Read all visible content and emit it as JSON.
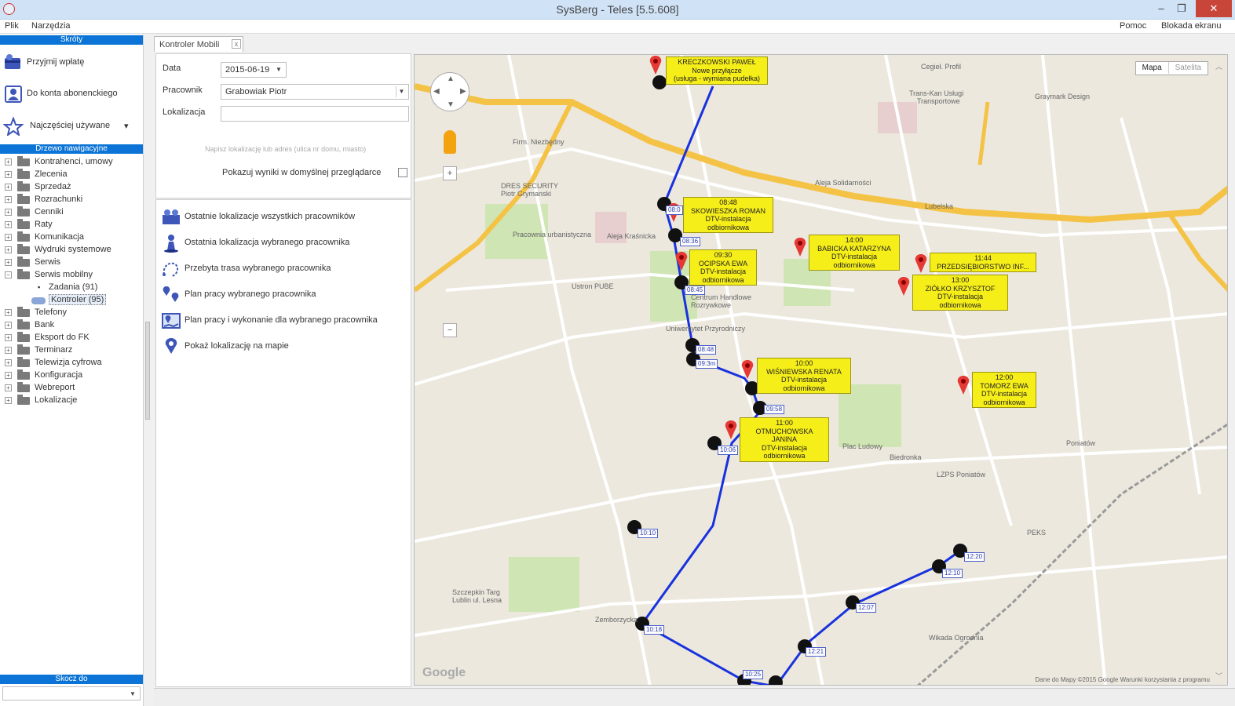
{
  "window": {
    "title": "SysBerg - Teles [5.5.608]",
    "controls": [
      "–",
      "❐",
      "✕"
    ]
  },
  "menu": {
    "left": [
      "Plik",
      "Narzędzia"
    ],
    "right": [
      "Pomoc",
      "Blokada ekranu"
    ]
  },
  "sidebar": {
    "skroty_header": "Skróty",
    "quick_actions": [
      {
        "label": "Przyjmij wpłatę",
        "icon": "payment-icon"
      },
      {
        "label": "Do konta abonenckiego",
        "icon": "subscriber-account-icon"
      },
      {
        "label": "Najczęściej używane",
        "icon": "star-icon",
        "arrow": "▾"
      }
    ],
    "nav_header": "Drzewo nawigacyjne",
    "tree": [
      {
        "label": "Kontrahenci, umowy"
      },
      {
        "label": "Zlecenia"
      },
      {
        "label": "Sprzedaż"
      },
      {
        "label": "Rozrachunki"
      },
      {
        "label": "Cenniki"
      },
      {
        "label": "Raty"
      },
      {
        "label": "Komunikacja"
      },
      {
        "label": "Wydruki systemowe"
      },
      {
        "label": "Serwis"
      },
      {
        "label": "Serwis mobilny",
        "expanded": true
      }
    ],
    "tree_children": [
      "Zadania (91)",
      "Kontroler (95)"
    ],
    "tree_after": [
      {
        "label": "Telefony"
      },
      {
        "label": "Bank"
      },
      {
        "label": "Eksport do FK"
      },
      {
        "label": "Terminarz"
      },
      {
        "label": "Telewizja cyfrowa"
      },
      {
        "label": "Konfiguracja"
      },
      {
        "label": "Webreport"
      },
      {
        "label": "Lokalizacje"
      }
    ],
    "skocz_header": "Skocz do",
    "skocz_value": ""
  },
  "panel": {
    "tab_label": "Kontroler Mobili",
    "tab_close": "x",
    "data_label": "Data",
    "data_value": "2015-06-19",
    "pracownik_label": "Pracownik",
    "pracownik_value": "Grabowiak Piotr",
    "lokalizacja_label": "Lokalizacja",
    "lokalizacja_value": "",
    "lokalizacja_hint": "Napisz lokalizację lub adres (ulica nr domu, miasto)",
    "checkbox_label": "Pokazuj wyniki w domyślnej przeglądarce",
    "checkbox_checked": false,
    "actions": [
      {
        "label": "Ostatnie lokalizacje wszystkich pracowników",
        "icon": "all-employees-location-icon"
      },
      {
        "label": "Ostatnia lokalizacja wybranego pracownika",
        "icon": "employee-location-icon"
      },
      {
        "label": "Przebyta trasa wybranego pracownika",
        "icon": "route-icon"
      },
      {
        "label": "Plan pracy wybranego pracownika",
        "icon": "work-plan-icon"
      },
      {
        "label": "Plan pracy i wykonanie dla wybranego pracownika",
        "icon": "plan-execution-icon"
      },
      {
        "label": "Pokaż lokalizację na mapie",
        "icon": "map-pin-icon"
      }
    ]
  },
  "map": {
    "type_buttons": [
      "Mapa",
      "Satelita"
    ],
    "google_logo": "Google",
    "copyright": "Dane do Mapy ©2015 Google   Warunki korzystania z programu",
    "callouts": [
      {
        "lines": [
          "KRECZKOWSKI PAWEŁ",
          "Nowe przyłącze",
          "(usługa - wymiana pudełka)"
        ]
      },
      {
        "lines": [
          "08:48",
          "SKOWIESZKA ROMAN",
          "DTV-instalacja",
          "odbiornikowa"
        ]
      },
      {
        "lines": [
          "09:30",
          "OCIPSKA EWA",
          "DTV-instalacja",
          "odbiornikowa"
        ]
      },
      {
        "lines": [
          "14:00",
          "BABICKA KATARZYNA",
          "DTV-instalacja",
          "odbiornikowa"
        ]
      },
      {
        "lines": [
          "11:44",
          "PRZEDSIĘBIORSTWO INF..."
        ]
      },
      {
        "lines": [
          "13:00",
          "ZIÓŁKO KRZYSZTOF",
          "DTV-instalacja",
          "odbiornikowa"
        ]
      },
      {
        "lines": [
          "10:00",
          "WIŚNIEWSKA RENATA",
          "DTV-instalacja",
          "odbiornikowa"
        ]
      },
      {
        "lines": [
          "12:00",
          "TOMORZ EWA",
          "DTV-instalacja",
          "odbiornikowa"
        ]
      },
      {
        "lines": [
          "11:00",
          "OTMUCHOWSKA JANINA",
          "DTV-instalacja",
          "odbiornikowa"
        ]
      }
    ],
    "track_labels": [
      "08:0",
      "08:36",
      "08:45",
      "08:48",
      "09:3m",
      "09:58",
      "10:06",
      "10:10",
      "10:18",
      "10:25",
      "12:20",
      "12:10",
      "12:07",
      "12:21"
    ],
    "labels": [
      "Cegieł. Profil",
      "Trans-Kan Usługi",
      "Transportowe",
      "Graymark Design",
      "Firm. Niezbędny",
      "DRES SECURITY",
      "Piotr Grymanski",
      "Pracownia urbanistyczna",
      "Ustron PUBE",
      "Centrum Handlowe",
      "Rozrywkowe",
      "Uniwersytet Przyrodniczy",
      "Plac Ludowy",
      "LZPS Poniatów",
      "Biedronka",
      "Poniatów",
      "PEKS",
      "Szczepkin Targ",
      "Wikada Ogrodnia",
      "Lublin ul. Lesna",
      "Zemborzycka",
      "Aleja Solidarności",
      "Aleja Kraśnicka",
      "Lubelska"
    ]
  }
}
